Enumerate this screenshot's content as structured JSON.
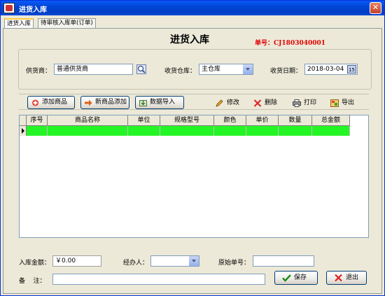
{
  "window": {
    "title": "进货入库",
    "close_label": "✕"
  },
  "tabs": [
    {
      "label": "进货入库"
    },
    {
      "label": "待审核入库单(订单)"
    }
  ],
  "form": {
    "title": "进货入库",
    "order_no": "单号：CJ1803040001",
    "supplier_label": "供货商：",
    "supplier_value": "普通供货商",
    "warehouse_label": "收货仓库：",
    "warehouse_value": "主仓库",
    "date_label": "收货日期：",
    "date_value": "2018-03-04"
  },
  "toolbar": {
    "add_product": "添加商品",
    "new_product_add": "新商品添加",
    "data_import": "数据导入",
    "edit": "修改",
    "delete": "删除",
    "print": "打印",
    "export": "导出"
  },
  "table": {
    "columns": [
      "序号",
      "商品名称",
      "单位",
      "规格型号",
      "颜色",
      "单价",
      "数量",
      "总金额"
    ]
  },
  "footer": {
    "amount_label": "入库金额：",
    "amount_value": "￥0.00",
    "handler_label": "经办人：",
    "handler_value": "",
    "original_no_label": "原始单号：",
    "original_no_value": "",
    "note_label": "备    注：",
    "note_value": "",
    "save_label": "保存",
    "exit_label": "退出"
  },
  "colors": {
    "title_bar": "#0046d5",
    "order_no": "#e00000",
    "selected_row": "#24f524"
  }
}
